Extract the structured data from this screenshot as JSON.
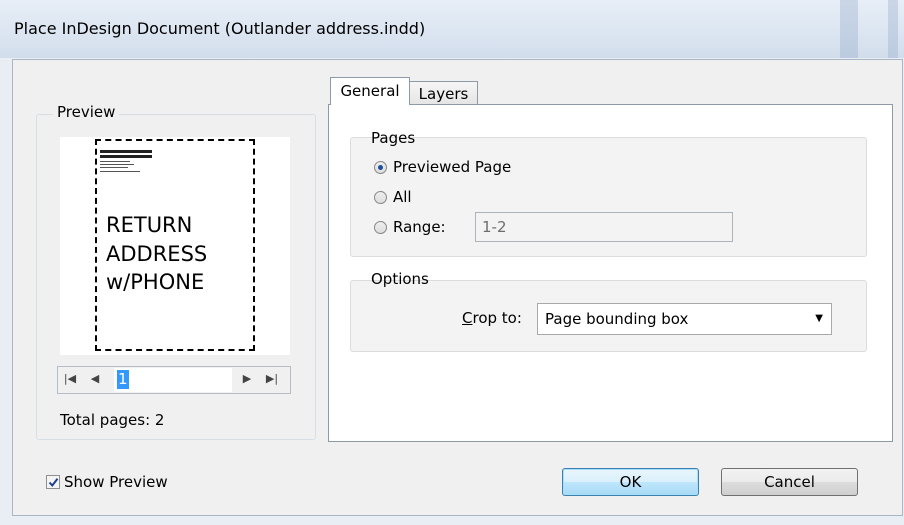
{
  "window": {
    "title": "Place InDesign Document (Outlander address.indd)"
  },
  "preview": {
    "group_label": "Preview",
    "page_text": "RETURN\nADDRESS\nw/PHONE",
    "current_page": "1",
    "total_pages_label": "Total pages: 2",
    "nav": {
      "first_icon": "first-page-icon",
      "prev_icon": "previous-page-icon",
      "next_icon": "next-page-icon",
      "last_icon": "last-page-icon"
    }
  },
  "tabs": [
    {
      "label": "General",
      "active": true
    },
    {
      "label": "Layers",
      "active": false
    }
  ],
  "pages": {
    "group_label": "Pages",
    "options": [
      {
        "label": "Previewed Page",
        "checked": true
      },
      {
        "label": "All",
        "checked": false
      },
      {
        "label": "Range:",
        "checked": false
      }
    ],
    "range_value": "1-2"
  },
  "options": {
    "group_label": "Options",
    "crop_label_accel": "C",
    "crop_label_rest": "rop to:",
    "crop_value": "Page bounding box"
  },
  "show_preview": {
    "label": "Show Preview",
    "checked": true
  },
  "buttons": {
    "ok": "OK",
    "cancel": "Cancel"
  },
  "colors": {
    "selection": "#3399ff",
    "radio_dot": "#1c4f9c",
    "default_button": "#a7d9f5"
  }
}
